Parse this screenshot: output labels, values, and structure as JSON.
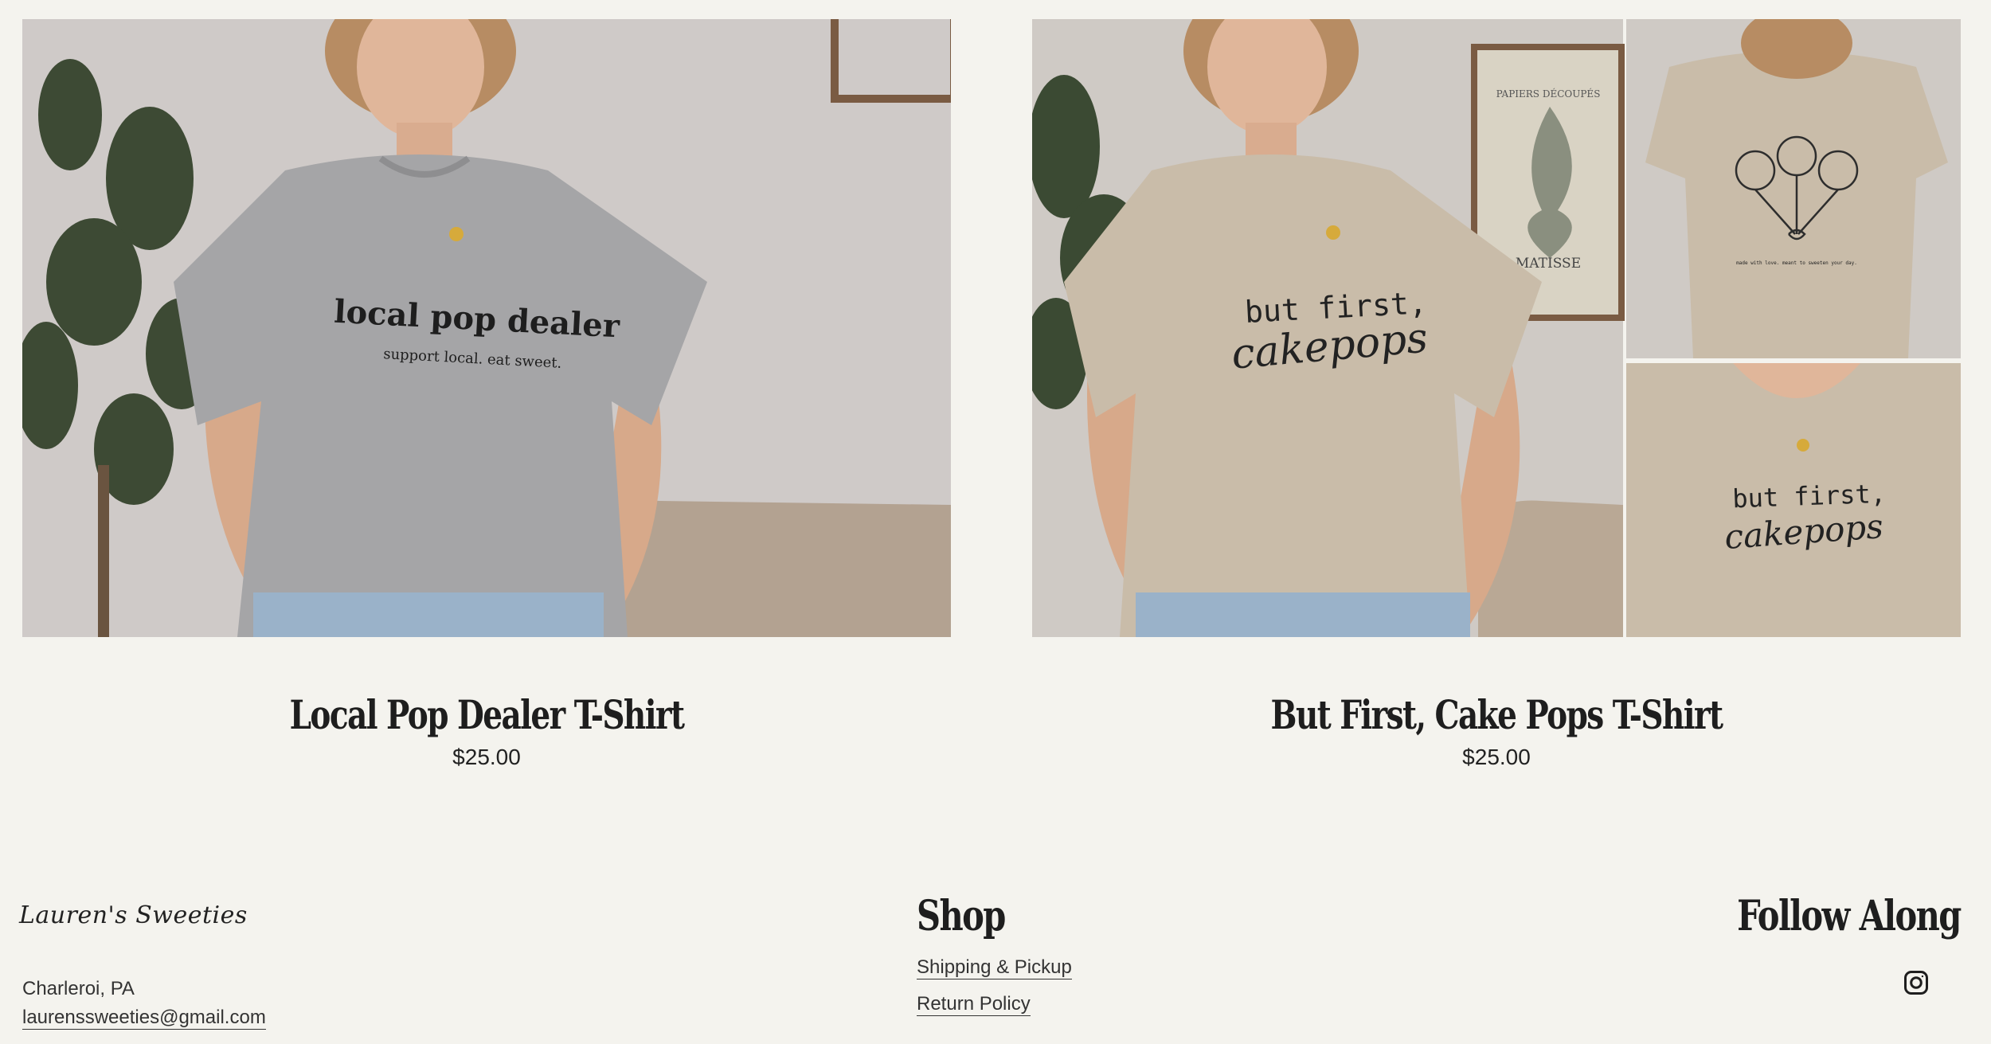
{
  "products": [
    {
      "title": "Local Pop Dealer T-Shirt",
      "price": "$25.00",
      "shirt_text_main": "local pop dealer",
      "shirt_text_sub": "support local. eat sweet.",
      "shirt_color": "#a5a5a7"
    },
    {
      "title": "But First, Cake Pops T-Shirt",
      "price": "$25.00",
      "shirt_text_line1": "but first,",
      "shirt_text_line2": "cakepops",
      "poster_title": "PAPIERS DÉCOUPÉS",
      "poster_name": "MATISSE",
      "back_print_text": "made with love. meant to sweeten your day.",
      "shirt_color": "#c9bca9"
    }
  ],
  "footer": {
    "logo": "Lauren's Sweeties",
    "city": "Charleroi, PA",
    "email": "laurenssweeties@gmail.com",
    "shop_heading": "Shop",
    "shop_links": [
      "Shipping & Pickup",
      "Return Policy"
    ],
    "follow_heading": "Follow Along",
    "social_icon": "instagram-icon"
  },
  "colors": {
    "background": "#f4f3ee",
    "text": "#1f1f1f"
  }
}
